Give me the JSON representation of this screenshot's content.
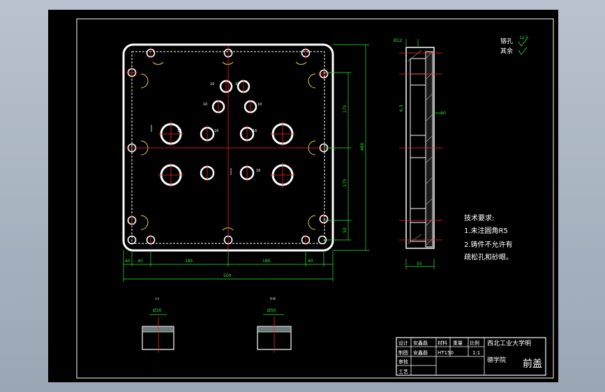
{
  "labels": {
    "front_dims": [
      "185",
      "185",
      "40",
      "40",
      "500"
    ],
    "right_dims": [
      "175",
      "175",
      "50",
      "480"
    ],
    "holes_small": [
      "10",
      "10",
      "10",
      "10"
    ],
    "holes_mid": [
      "16",
      "16"
    ],
    "holes_big": [
      "16",
      "16"
    ],
    "side_dims": [
      "Ø12",
      "10",
      "55",
      "6.3"
    ],
    "detail_titles": [
      "I-I",
      "II-II"
    ],
    "detail_dims": [
      "Ø30",
      "Ø50"
    ]
  },
  "surface_symbols": {
    "line1": "铬孔",
    "line1_val": "12.5",
    "line2": "其余"
  },
  "notes": {
    "title": "技术要求:",
    "item1": "1.未注圆角R5",
    "item2": "2.铸件不允许有",
    "item3": "疏松孔和砂眼。"
  },
  "title_block": {
    "design_label": "设计",
    "design_name": "安鑫磊",
    "draw_label": "制图",
    "draw_name": "安鑫磊",
    "review_label": "审核",
    "craft_label": "工艺",
    "material_label": "材料",
    "material": "HT150",
    "weight_label": "重量",
    "scale_label": "比例",
    "scale": "1:1",
    "school_line1": "西北工业大学明",
    "school_line2": "德学院",
    "part_name": "前盖"
  }
}
